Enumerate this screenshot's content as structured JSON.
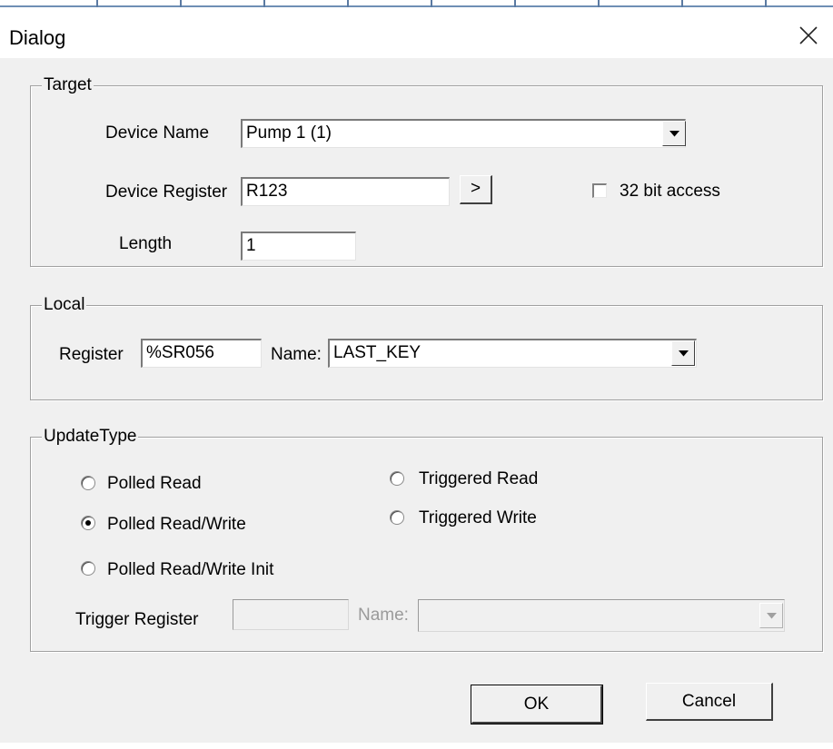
{
  "window": {
    "title": "Dialog"
  },
  "target": {
    "legend": "Target",
    "device_name_label": "Device Name",
    "device_name_value": "Pump 1 (1)",
    "device_register_label": "Device Register",
    "device_register_value": "R123",
    "browse_button_label": ">",
    "bit32_label": "32 bit access",
    "bit32_checked": false,
    "length_label": "Length",
    "length_value": "1"
  },
  "local": {
    "legend": "Local",
    "register_label": "Register",
    "register_value": "%SR056",
    "name_label": "Name:",
    "name_value": "LAST_KEY"
  },
  "update_type": {
    "legend": "UpdateType",
    "options": [
      {
        "label": "Polled Read",
        "selected": false
      },
      {
        "label": "Polled Read/Write",
        "selected": true
      },
      {
        "label": "Polled Read/Write Init",
        "selected": false
      },
      {
        "label": "Triggered Read",
        "selected": false
      },
      {
        "label": "Triggered Write",
        "selected": false
      }
    ],
    "trigger_register_label": "Trigger Register",
    "trigger_register_value": "",
    "trigger_name_label": "Name:",
    "trigger_name_value": ""
  },
  "buttons": {
    "ok": "OK",
    "cancel": "Cancel"
  }
}
